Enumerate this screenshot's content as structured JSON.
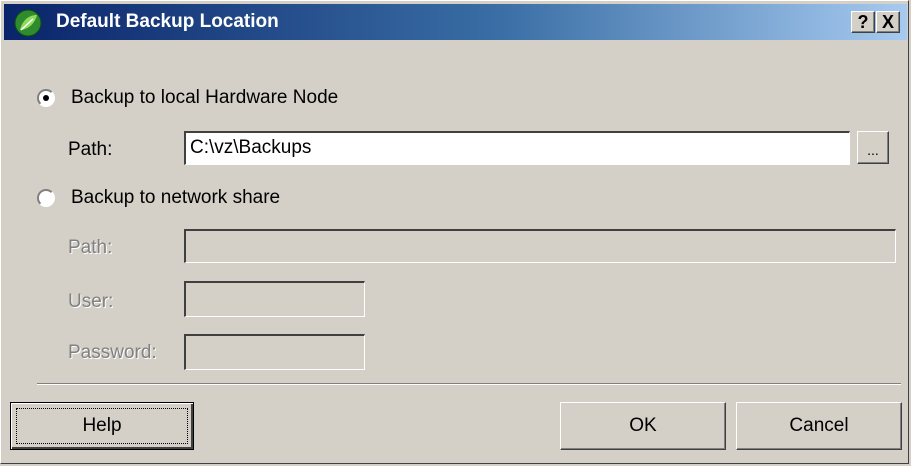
{
  "window": {
    "title": "Default Backup Location",
    "help_button": "?",
    "close_button": "X"
  },
  "local": {
    "option_label": "Backup to local Hardware Node",
    "selected": true,
    "path_label": "Path:",
    "path_value": "C:\\vz\\Backups",
    "browse_label": "..."
  },
  "network": {
    "option_label": "Backup to network share",
    "selected": false,
    "path_label": "Path:",
    "path_value": "",
    "user_label": "User:",
    "user_value": "",
    "password_label": "Password:",
    "password_value": ""
  },
  "buttons": {
    "help": "Help",
    "ok": "OK",
    "cancel": "Cancel"
  }
}
